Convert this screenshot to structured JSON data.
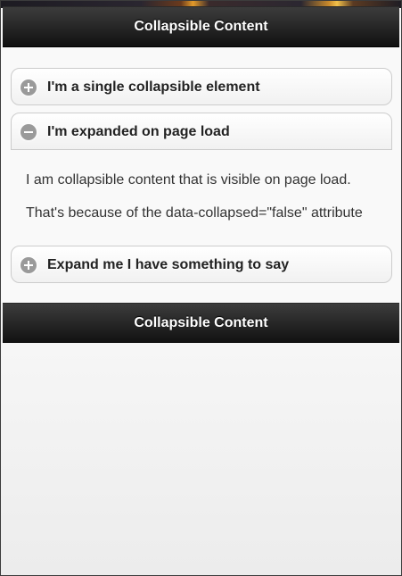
{
  "header": {
    "title": "Collapsible Content"
  },
  "footer": {
    "title": "Collapsible Content"
  },
  "collapsibles": [
    {
      "heading": "I'm a single collapsible element",
      "state": "collapsed",
      "icon": "plus-icon"
    },
    {
      "heading": "I'm expanded on page load",
      "state": "expanded",
      "icon": "minus-icon",
      "content": [
        "I am collapsible content that is visible on page load.",
        "That's because of the data-collapsed=\"false\" attribute"
      ]
    },
    {
      "heading": "Expand me I have something to say",
      "state": "collapsed",
      "icon": "plus-icon"
    }
  ],
  "colors": {
    "bar": "#1a1a1a",
    "bar_text": "#ffffff",
    "icon_bg": "#9a9a9a",
    "heading_text": "#222222",
    "body_text": "#333333"
  }
}
